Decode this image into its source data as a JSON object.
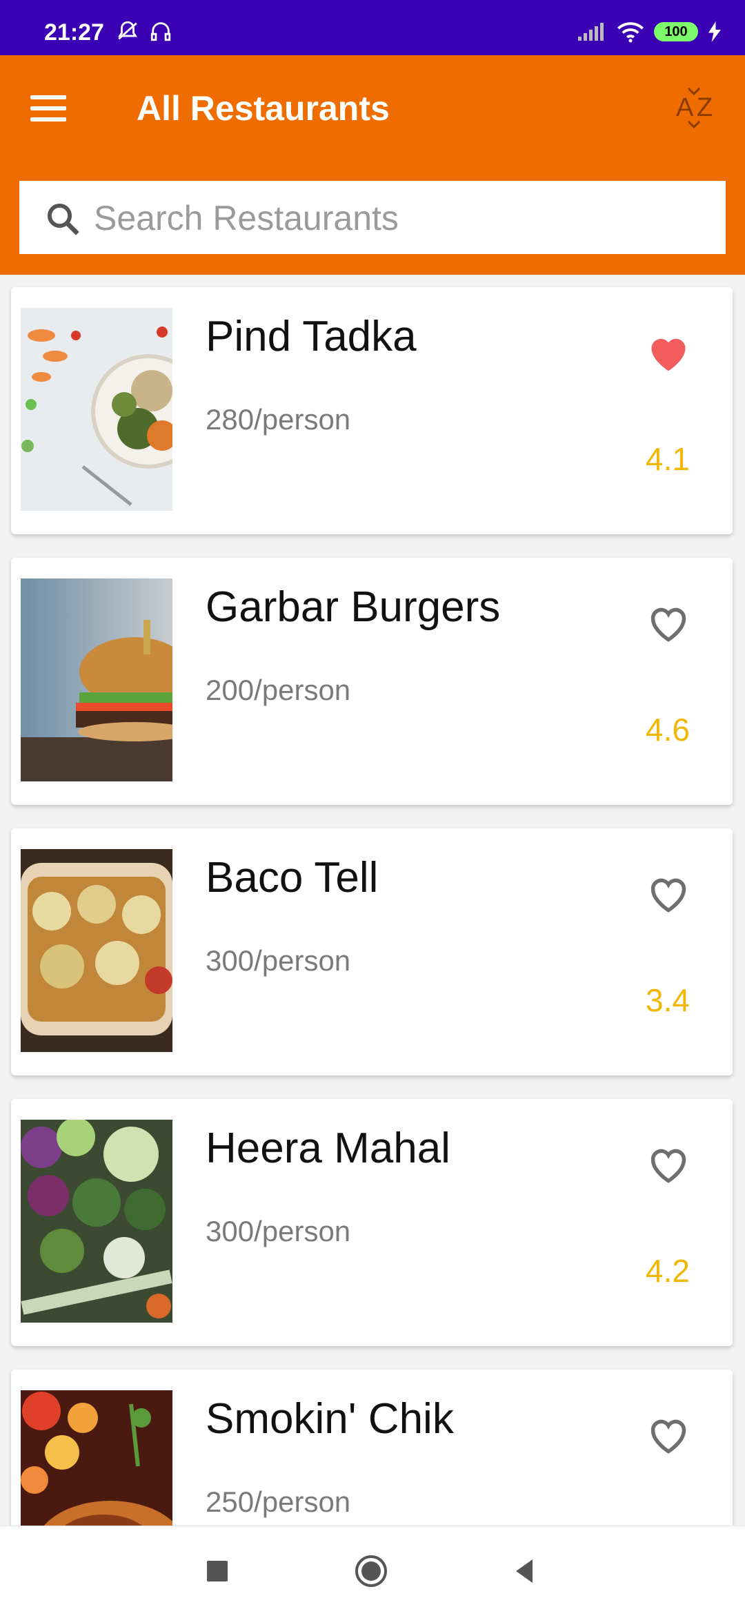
{
  "status_bar": {
    "time": "21:27",
    "battery": "100"
  },
  "app_bar": {
    "title": "All Restaurants",
    "sort_icon": "sort-az-icon",
    "menu_icon": "hamburger-menu-icon"
  },
  "search": {
    "placeholder": "Search Restaurants",
    "value": ""
  },
  "colors": {
    "primary": "#ee6c00",
    "status_bar": "#3b00b3",
    "rating": "#f2b705",
    "favorite": "#f25c5c"
  },
  "restaurants": [
    {
      "name": "Pind Tadka",
      "price": "280/person",
      "rating": "4.1",
      "favorite": true
    },
    {
      "name": "Garbar Burgers",
      "price": "200/person",
      "rating": "4.6",
      "favorite": false
    },
    {
      "name": "Baco Tell",
      "price": "300/person",
      "rating": "3.4",
      "favorite": false
    },
    {
      "name": "Heera Mahal",
      "price": "300/person",
      "rating": "4.2",
      "favorite": false
    },
    {
      "name": "Smokin' Chik",
      "price": "250/person",
      "rating": "",
      "favorite": false
    }
  ],
  "nav": {
    "recents": "recents-square-icon",
    "home": "home-circle-icon",
    "back": "back-triangle-icon"
  }
}
